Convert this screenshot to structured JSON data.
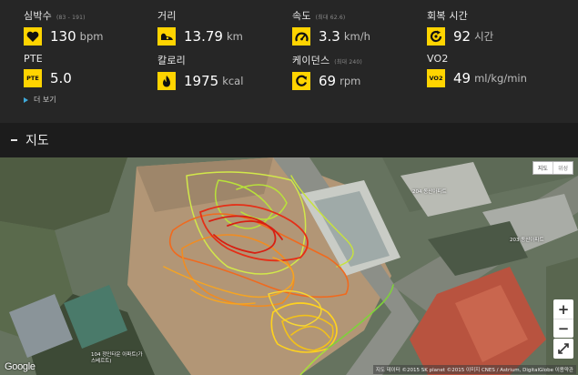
{
  "stats": {
    "heart_rate": {
      "label": "심박수",
      "sub": "(83 - 191)",
      "value": "130",
      "unit": "bpm",
      "icon": "heart-icon"
    },
    "distance": {
      "label": "거리",
      "value": "13.79",
      "unit": "km",
      "icon": "shoe-icon"
    },
    "speed": {
      "label": "속도",
      "sub": "(최대 62.6)",
      "value": "3.3",
      "unit": "km/h",
      "icon": "speedometer-icon"
    },
    "recovery": {
      "label": "회복 시간",
      "value": "92",
      "unit": "시간",
      "icon": "recovery-icon"
    },
    "pte": {
      "label": "PTE",
      "icon_text": "PTE",
      "value": "5.0"
    },
    "calories": {
      "label": "칼로리",
      "value": "1975",
      "unit": "kcal",
      "icon": "flame-icon"
    },
    "cadence": {
      "label": "케이던스",
      "sub": "(최대 240)",
      "value": "69",
      "unit": "rpm",
      "icon": "cadence-icon"
    },
    "vo2": {
      "label": "VO2",
      "icon_text": "VO2",
      "value": "49",
      "unit": "ml/kg/min"
    }
  },
  "more_label": "더 보기",
  "section_title": "지도",
  "map": {
    "toggle": [
      "지도",
      "위성"
    ],
    "labels": [
      "204 동산아파트",
      "203 동산아파트",
      "104 정인타운 아파트(가스베르트)"
    ],
    "logo": "Google",
    "attribution": "지도 데이터 ©2015 SK planet ©2015 이미지 CNES / Astrium, DigitalGlobe 이용약관",
    "accent": "#ffd400"
  }
}
